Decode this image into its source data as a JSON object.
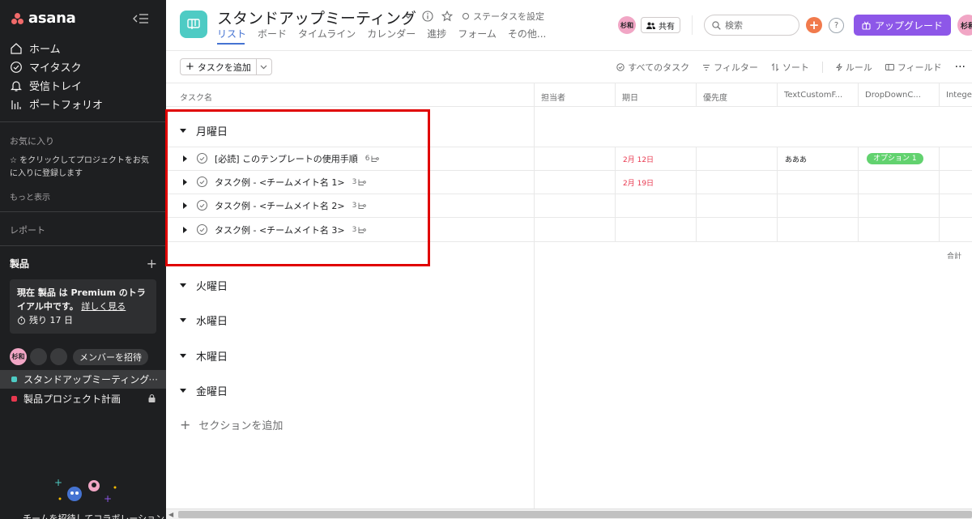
{
  "sidebar": {
    "logo_text": "asana",
    "nav": [
      {
        "label": "ホーム",
        "icon": "home-icon"
      },
      {
        "label": "マイタスク",
        "icon": "check-circle-icon"
      },
      {
        "label": "受信トレイ",
        "icon": "bell-icon"
      },
      {
        "label": "ポートフォリオ",
        "icon": "bar-chart-icon"
      }
    ],
    "favorites_title": "お気に入り",
    "favorites_hint": "☆ をクリックしてプロジェクトをお気に入りに登録します",
    "show_more": "もっと表示",
    "reports": "レポート",
    "team_title": "製品",
    "trial": {
      "text_bold": "現在 製品 は Premium のトライアル中です。",
      "link": "詳しく見る",
      "days": "残り 17 日"
    },
    "member_avatar": "杉和",
    "invite_label": "メンバーを招待",
    "projects": [
      {
        "label": "スタンドアップミーティング",
        "color": "#4ecbc4",
        "suffix": "···"
      },
      {
        "label": "製品プロジェクト計画",
        "color": "#e8384f",
        "suffix": ""
      }
    ],
    "bottom_text": "チームを招待してコラボレーション"
  },
  "header": {
    "title": "スタンドアップミーティング",
    "status_label": "ステータスを設定",
    "tabs": [
      "リスト",
      "ボード",
      "タイムライン",
      "カレンダー",
      "進捗",
      "フォーム",
      "その他..."
    ],
    "avatar": "杉和",
    "share_label": "共有",
    "search_placeholder": "検索",
    "help": "?",
    "upgrade_label": "アップグレード",
    "avatar2": "杉和"
  },
  "toolbar": {
    "add_task": "タスクを追加",
    "all_tasks": "すべてのタスク",
    "filter": "フィルター",
    "sort": "ソート",
    "rules": "ルール",
    "fields": "フィールド",
    "more": "···"
  },
  "columns": [
    "タスク名",
    "担当者",
    "期日",
    "優先度",
    "TextCustomF...",
    "DropDownC...",
    "Integer"
  ],
  "sections": [
    "月曜日",
    "火曜日",
    "水曜日",
    "木曜日",
    "金曜日"
  ],
  "tasks": [
    {
      "name": "[必読] このテンプレートの使用手順",
      "subtasks": "6",
      "due": "2月 12日",
      "text_field": "あああ",
      "dropdown": "オプション 1"
    },
    {
      "name": "タスク例 - <チームメイト名 1>",
      "subtasks": "3",
      "due": "2月 19日",
      "text_field": "",
      "dropdown": ""
    },
    {
      "name": "タスク例 - <チームメイト名 2>",
      "subtasks": "3",
      "due": "",
      "text_field": "",
      "dropdown": ""
    },
    {
      "name": "タスク例 - <チームメイト名 3>",
      "subtasks": "3",
      "due": "",
      "text_field": "",
      "dropdown": ""
    }
  ],
  "total_label": "合計",
  "add_section": "セクションを追加",
  "colors": {
    "accent": "#4573d2",
    "due_red": "#e8384f",
    "upgrade": "#8d57e8",
    "highlight": "#e00000",
    "badge_green": "#62d26f"
  }
}
